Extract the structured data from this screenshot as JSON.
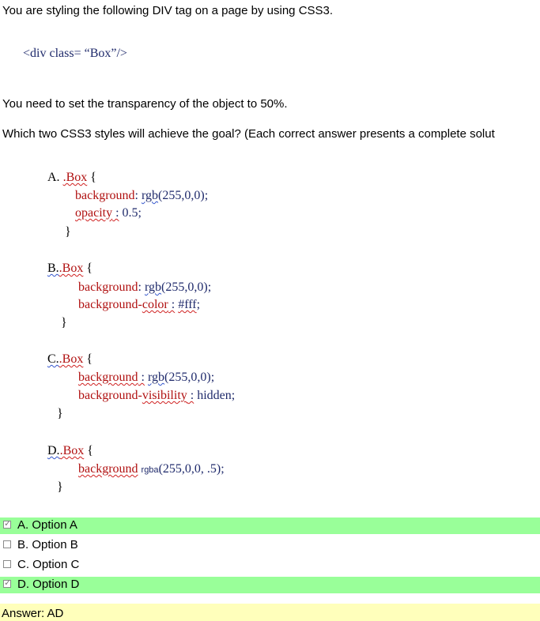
{
  "question": {
    "intro": "You are styling the following DIV tag on a page by using CSS3.",
    "code_line": "<div class= “Box”/>",
    "requirement": "You need to set the transparency of the object to 50%.",
    "prompt": "Which two CSS3 styles will achieve the goal? (Each correct answer presents a complete solut"
  },
  "choices": [
    {
      "letter": "A.",
      "selector": ".Box",
      "open": "{",
      "lines": [
        {
          "prop": "background",
          "sep": ":",
          "value_fn": "rgb",
          "value_rest": "(255,0,0);"
        },
        {
          "prop": "opacity",
          "sep": " :",
          "value_fn": "",
          "value_rest": "0.5;"
        }
      ],
      "close": "}"
    },
    {
      "letter": "B.",
      "selector": ".Box",
      "open": "{",
      "lines": [
        {
          "prop": "background",
          "sep": ":",
          "value_fn": "rgb",
          "value_rest": "(255,0,0);"
        },
        {
          "prop_a": "background-",
          "prop_b": "color",
          "sep": " :",
          "value_fn": "#fff",
          "value_rest": ";"
        }
      ],
      "close": "}"
    },
    {
      "letter": "C.",
      "selector": ".Box",
      "open": "{",
      "lines": [
        {
          "prop": "background",
          "sep": " :",
          "value_fn": "rgb",
          "value_rest": "(255,0,0);"
        },
        {
          "prop_a": "background-",
          "prop_b": "visibility",
          "sep": " :",
          "value_fn": "",
          "value_rest": "hidden;"
        }
      ],
      "close": "}"
    },
    {
      "letter": "D.",
      "selector": ".Box",
      "open": "{",
      "lines": [
        {
          "prop": "background",
          "sep": "",
          "value_fn": "rgba",
          "value_rest": "(255,0,0, .5);"
        }
      ],
      "close": "}"
    }
  ],
  "options": [
    {
      "label": "A. Option A",
      "checked": true,
      "correct": true
    },
    {
      "label": "B. Option B",
      "checked": false,
      "correct": false
    },
    {
      "label": "C. Option C",
      "checked": false,
      "correct": false
    },
    {
      "label": "D. Option D",
      "checked": true,
      "correct": true
    }
  ],
  "answer": "Answer: AD",
  "colors": {
    "correct_bg": "#99ff99",
    "answer_bg": "#ffffbb",
    "code_navy": "#1f2a6b",
    "code_red": "#b01010"
  }
}
